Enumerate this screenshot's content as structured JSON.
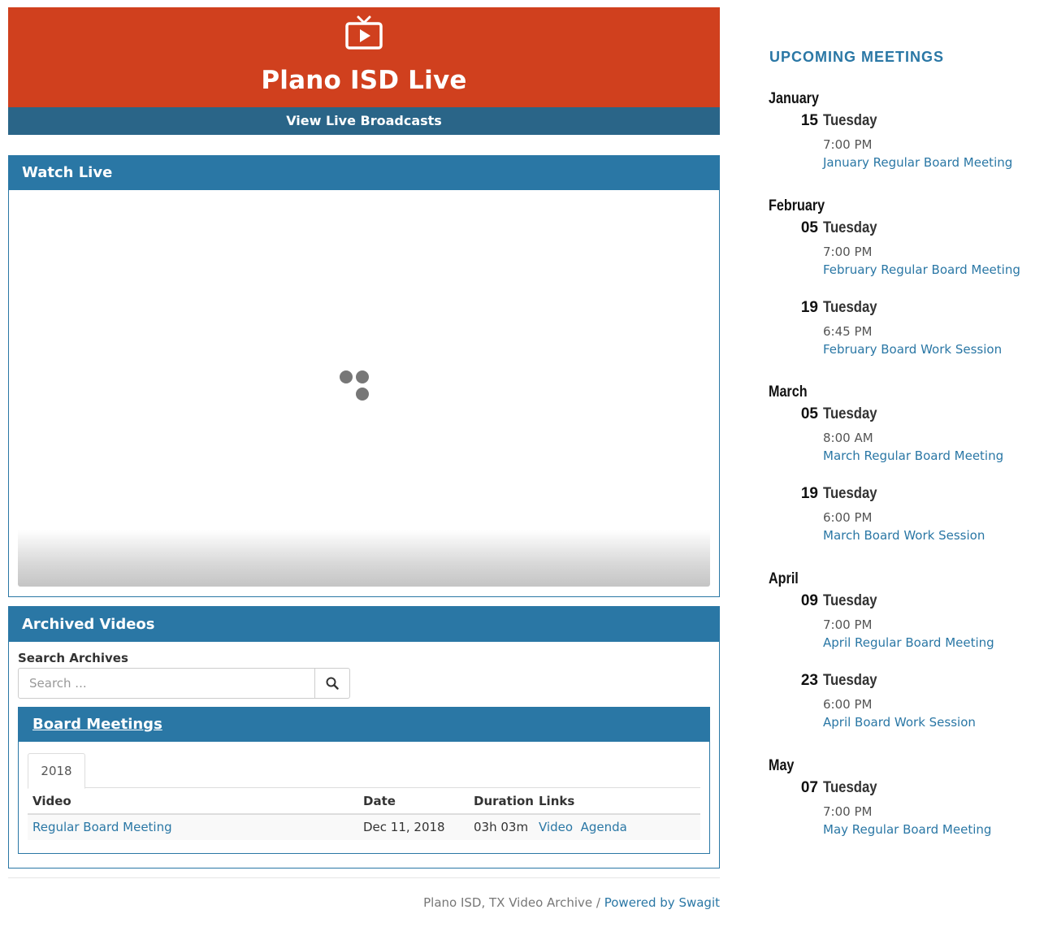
{
  "header": {
    "icon": "tv-play-icon",
    "title": "Plano ISD Live",
    "live_link": "View Live Broadcasts",
    "colors": {
      "hero": "#d0401e",
      "bar": "#2a6588",
      "panel": "#2a77a5"
    }
  },
  "watch": {
    "heading": "Watch Live",
    "loading_icon": "loading-dots-icon"
  },
  "archive": {
    "heading": "Archived Videos",
    "search_label": "Search Archives",
    "search_placeholder": "Search ...",
    "search_icon": "search-icon",
    "category": "Board Meetings",
    "tab": "2018",
    "columns": {
      "video": "Video",
      "date": "Date",
      "duration": "Duration",
      "links": "Links"
    },
    "rows": [
      {
        "video": "Regular Board Meeting",
        "date": "Dec 11, 2018",
        "duration": "03h 03m",
        "link_video": "Video",
        "link_agenda": "Agenda"
      }
    ]
  },
  "footer": {
    "text": "Plano ISD, TX Video Archive / ",
    "powered": "Powered by Swagit"
  },
  "upcoming": {
    "title": "UPCOMING MEETINGS",
    "months": [
      {
        "name": "January",
        "events": [
          {
            "day": "15",
            "weekday": "Tuesday",
            "time": "7:00 PM",
            "title": "January Regular Board Meeting"
          }
        ]
      },
      {
        "name": "February",
        "events": [
          {
            "day": "05",
            "weekday": "Tuesday",
            "time": "7:00 PM",
            "title": "February Regular Board Meeting"
          },
          {
            "day": "19",
            "weekday": "Tuesday",
            "time": "6:45 PM",
            "title": "February Board Work Session"
          }
        ]
      },
      {
        "name": "March",
        "events": [
          {
            "day": "05",
            "weekday": "Tuesday",
            "time": "8:00 AM",
            "title": "March Regular Board Meeting"
          },
          {
            "day": "19",
            "weekday": "Tuesday",
            "time": "6:00 PM",
            "title": "March Board Work Session"
          }
        ]
      },
      {
        "name": "April",
        "events": [
          {
            "day": "09",
            "weekday": "Tuesday",
            "time": "7:00 PM",
            "title": "April Regular Board Meeting"
          },
          {
            "day": "23",
            "weekday": "Tuesday",
            "time": "6:00 PM",
            "title": "April Board Work Session"
          }
        ]
      },
      {
        "name": "May",
        "events": [
          {
            "day": "07",
            "weekday": "Tuesday",
            "time": "7:00 PM",
            "title": "May Regular Board Meeting"
          }
        ]
      }
    ]
  }
}
